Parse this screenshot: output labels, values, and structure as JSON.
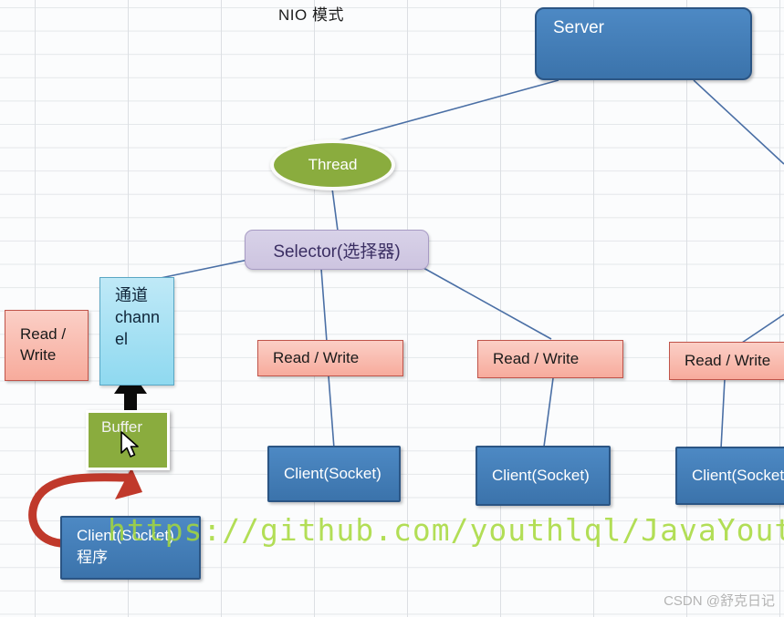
{
  "title": "NIO 模式",
  "watermarks": {
    "github": "https://github.com/youthlql/JavaYouth",
    "csdn": "CSDN @舒克日记"
  },
  "colors": {
    "blue_fill": "#3b73ab",
    "blue_border": "#2b5584",
    "olive": "#8aac3e",
    "selector_fill": "#cdc4e0",
    "selector_text": "#3b2f63",
    "pink_fill": "#f7ab9c",
    "pink_border": "#c0544a",
    "cyan_fill": "#8fd9f0",
    "line": "#4a6fa5",
    "red_arrow": "#c0392b",
    "grid": "#dcdfe3",
    "watermark_green": "#a6d93a"
  },
  "nodes": {
    "server": {
      "label": "Server"
    },
    "thread": {
      "label": "Thread"
    },
    "selector": {
      "label": "Selector(选择器)"
    },
    "channel": {
      "label": "通道\nchann\nel"
    },
    "buffer": {
      "label": "Buffer"
    },
    "read_write_left": {
      "label": "Read /\nWrite"
    },
    "read_write_1": {
      "label": "Read / Write"
    },
    "read_write_2": {
      "label": "Read / Write"
    },
    "read_write_3": {
      "label": "Read / Write"
    },
    "client_program": {
      "label": "Client(Socket)\n程序"
    },
    "client_1": {
      "label": "Client(Socket)"
    },
    "client_2": {
      "label": "Client(Socket)"
    },
    "client_3": {
      "label": "Client(Socket)"
    }
  },
  "connectors": [
    {
      "name": "server-to-thread",
      "from": "server",
      "to": "thread"
    },
    {
      "name": "server-to-right-edge",
      "from": "server",
      "to": "offscreen-right"
    },
    {
      "name": "thread-to-selector",
      "from": "thread",
      "to": "selector"
    },
    {
      "name": "selector-to-channel",
      "from": "selector",
      "to": "channel"
    },
    {
      "name": "selector-to-read-write-1",
      "from": "selector",
      "to": "read_write_1"
    },
    {
      "name": "selector-to-read-write-2",
      "from": "selector",
      "to": "read_write_2"
    },
    {
      "name": "read-write-1-to-client-1",
      "from": "read_write_1",
      "to": "client_1"
    },
    {
      "name": "read-write-2-to-client-2",
      "from": "read_write_2",
      "to": "client_2"
    },
    {
      "name": "read-write-3-to-client-3",
      "from": "read_write_3",
      "to": "client_3"
    },
    {
      "name": "channel-to-buffer-double-arrow",
      "from": "channel",
      "to": "buffer"
    },
    {
      "name": "client-program-to-buffer-curved",
      "from": "client_program",
      "to": "buffer"
    }
  ]
}
